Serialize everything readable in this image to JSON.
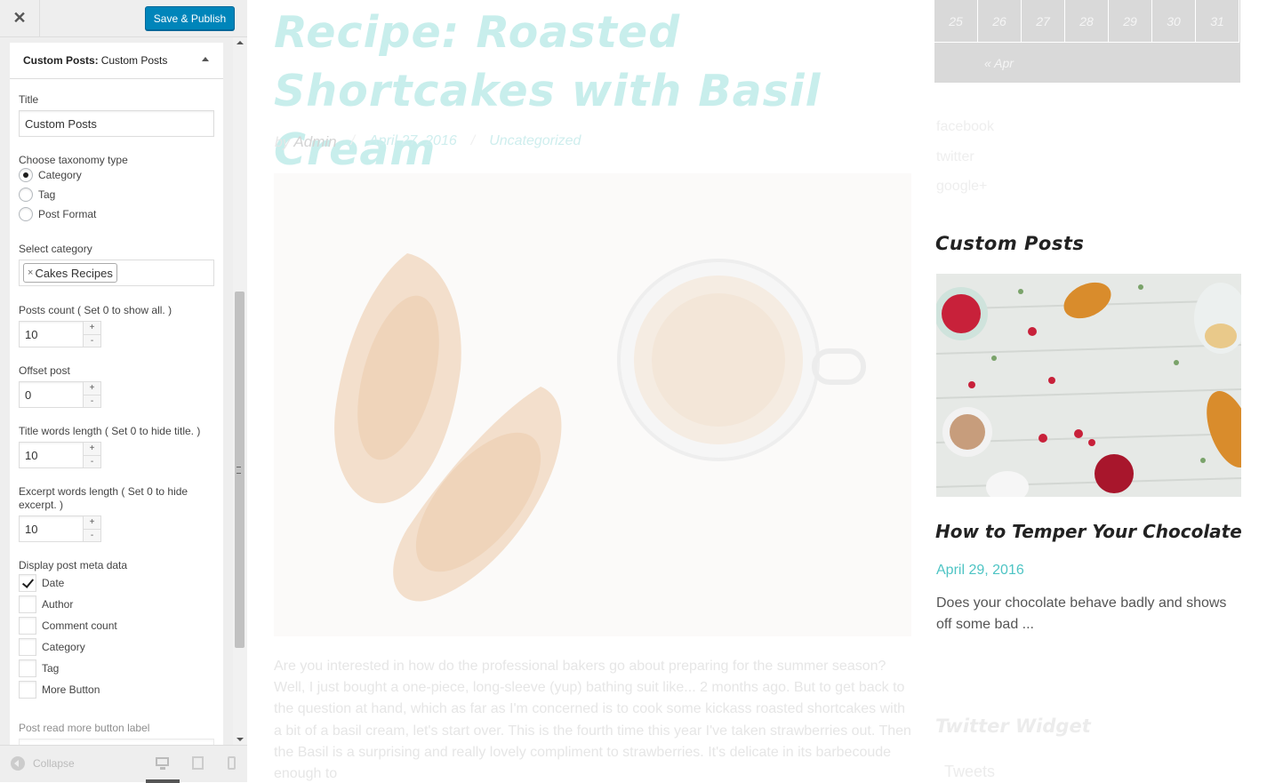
{
  "customizer": {
    "close_icon": "close-icon",
    "save_label": "Save & Publish",
    "section": {
      "title_bold": "Custom Posts:",
      "title_rest": "Custom Posts"
    },
    "fields": {
      "title_label": "Title",
      "title_value": "Custom Posts",
      "taxonomy_label": "Choose taxonomy type",
      "taxonomy_options": [
        "Category",
        "Tag",
        "Post Format"
      ],
      "taxonomy_selected": "Category",
      "category_label": "Select category",
      "category_chip": "Cakes Recipes",
      "posts_count_label": "Posts count ( Set 0 to show all. )",
      "posts_count_value": "10",
      "offset_label": "Offset post",
      "offset_value": "0",
      "title_words_label": "Title words length ( Set 0 to hide title. )",
      "title_words_value": "10",
      "excerpt_words_label": "Excerpt words length ( Set 0 to hide excerpt. )",
      "excerpt_words_value": "10",
      "meta_label": "Display post meta data",
      "meta_options": [
        "Date",
        "Author",
        "Comment count",
        "Category",
        "Tag",
        "More Button"
      ],
      "meta_checked": [
        "Date"
      ],
      "read_more_label": "Post read more button label"
    },
    "footer": {
      "collapse_label": "Collapse"
    }
  },
  "preview": {
    "post_title": "Recipe: Roasted Shortcakes with Basil Cream",
    "post_meta": {
      "by": "by",
      "author": "Admin",
      "date": "April 27, 2016",
      "category": "Uncategorized"
    },
    "post_excerpt": "Are you interested in how do the professional bakers go about preparing for the summer season? Well, I just bought a one-piece, long-sleeve (yup) bathing suit like... 2 months ago. But to get back to the question at hand, which as far as I'm concerned is to cook some kickass roasted shortcakes with a bit of a basil cream, let's start over. This is the fourth time this year I've taken strawberries out. Then the Basil is a surprising and really lovely compliment to strawberries. It's delicate in its barbecoude enough to",
    "calendar": {
      "days": [
        "25",
        "26",
        "27",
        "28",
        "29",
        "30",
        "31"
      ],
      "prev_link": "« Apr"
    },
    "social_links": [
      "facebook",
      "twitter",
      "google+"
    ],
    "widget": {
      "title": "Custom Posts",
      "post_title": "How to Temper Your Chocolate",
      "post_date": "April 29, 2016",
      "post_excerpt": "Does your chocolate behave badly and shows off some bad ..."
    },
    "twitter_widget_title": "Twitter Widget",
    "tweets_label": "Tweets"
  }
}
